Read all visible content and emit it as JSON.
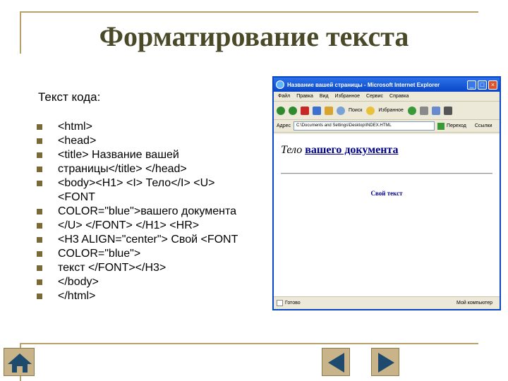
{
  "slide": {
    "title": "Форматирование текста",
    "code_label": "Текст кода:",
    "code_lines": [
      "<html>",
      "<head>",
      "<title> Название вашей",
      "страницы</title> </head>",
      "<body><H1> <I> Тело</I> <U>",
      "<FONT",
      "COLOR=\"blue\">вашего документа",
      "</U> </FONT> </H1> <HR>",
      "<H3 ALIGN=\"center\"> Свой <FONT",
      "COLOR=\"blue\">",
      "текст </FONT></H3>",
      "</body>",
      "</html>"
    ]
  },
  "browser": {
    "title": "Название вашей страницы - Microsoft Internet Explorer",
    "menu": [
      "Файл",
      "Правка",
      "Вид",
      "Избранное",
      "Сервис",
      "Справка"
    ],
    "toolbar": {
      "search": "Поиск",
      "favorites": "Избранное"
    },
    "address": {
      "label": "Адрес",
      "value": "C:\\Documents and Settings\\Desktop\\INDEX.HTML",
      "go": "Переход",
      "links": "Ссылки"
    },
    "page": {
      "italic_word": "Тело",
      "linked_text": "вашего документа",
      "h3": "Свой текст"
    },
    "status": {
      "left": "Готово",
      "right": "Мой компьютер"
    }
  },
  "nav": {
    "home": "home-icon",
    "prev": "triangle-left-icon",
    "next": "triangle-right-icon",
    "accent": "#1e4a6e"
  }
}
